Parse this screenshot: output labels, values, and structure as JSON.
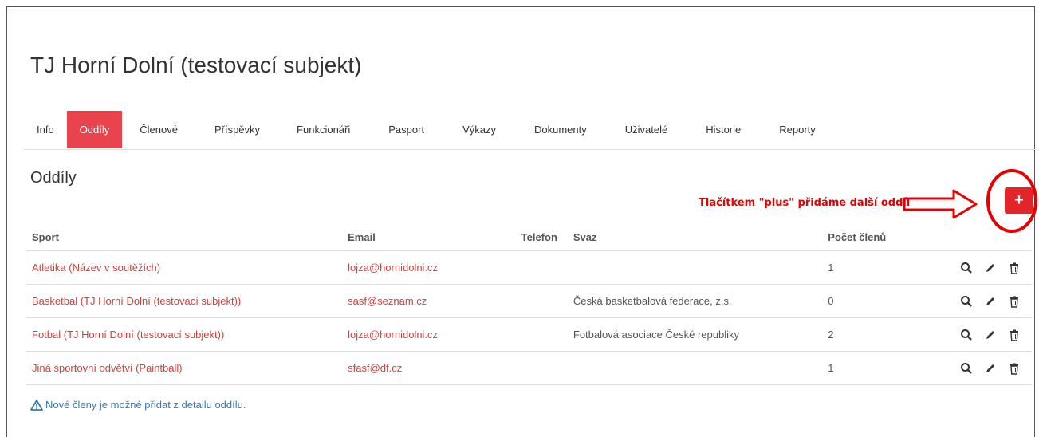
{
  "header": {
    "title": "TJ Horní Dolní (testovací subjekt)"
  },
  "tabs": [
    {
      "label": "Info",
      "active": false
    },
    {
      "label": "Oddíly",
      "active": true
    },
    {
      "label": "Členové",
      "active": false
    },
    {
      "label": "Příspěvky",
      "active": false
    },
    {
      "label": "Funkcionáři",
      "active": false
    },
    {
      "label": "Pasport",
      "active": false
    },
    {
      "label": "Výkazy",
      "active": false
    },
    {
      "label": "Dokumenty",
      "active": false
    },
    {
      "label": "Uživatelé",
      "active": false
    },
    {
      "label": "Historie",
      "active": false
    },
    {
      "label": "Reporty",
      "active": false
    }
  ],
  "section": {
    "title": "Oddíly",
    "add_label": "+"
  },
  "annotation": {
    "text": "Tlačítkem \"plus\" přidáme další oddíl",
    "color": "#e60000"
  },
  "table": {
    "columns": {
      "sport": "Sport",
      "email": "Email",
      "telefon": "Telefon",
      "svaz": "Svaz",
      "pocet": "Počet členů"
    },
    "rows": [
      {
        "sport": "Atletika (Název v soutěžích)",
        "email": "lojza@hornidolni.cz",
        "telefon": "",
        "svaz": "",
        "pocet": "1"
      },
      {
        "sport": "Basketbal (TJ Horní Dolní (testovací subjekt))",
        "email": "sasf@seznam.cz",
        "telefon": "",
        "svaz": "Česká basketbalová federace, z.s.",
        "pocet": "0"
      },
      {
        "sport": "Fotbal (TJ Horní Dolní (testovací subjekt))",
        "email": "lojza@hornidolni.cz",
        "telefon": "",
        "svaz": "Fotbalová asociace České republiky",
        "pocet": "2"
      },
      {
        "sport": "Jiná sportovní odvětví (Paintball)",
        "email": "sfasf@df.cz",
        "telefon": "",
        "svaz": "",
        "pocet": "1"
      }
    ]
  },
  "note": {
    "text": "Nové členy je možné přidat z detailu oddílu."
  },
  "colors": {
    "accent": "#e9444d",
    "link": "#d43f3a",
    "note": "#337ab7"
  }
}
